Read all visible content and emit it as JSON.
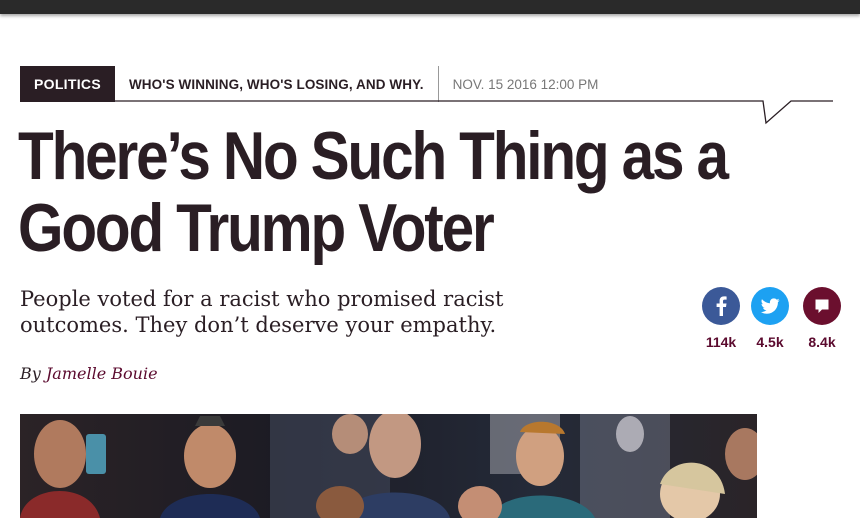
{
  "article": {
    "section": "POLITICS",
    "series": "WHO'S WINNING, WHO'S LOSING, AND WHY.",
    "date": "NOV. 15 2016 12:00 PM",
    "headline_line1": "There’s No Such Thing as a",
    "headline_line2": "Good Trump Voter",
    "dek_line1": "People voted for a racist who promised racist",
    "dek_line2": "outcomes. They don’t deserve your empathy.",
    "byline_prefix": "By",
    "author": "Jamelle Bouie"
  },
  "share": {
    "facebook": {
      "icon": "facebook-icon",
      "count": "114k",
      "color": "#3b5998"
    },
    "twitter": {
      "icon": "twitter-icon",
      "count": "4.5k",
      "color": "#1da1f2"
    },
    "comments": {
      "icon": "comment-icon",
      "count": "8.4k",
      "color": "#6b0f2e"
    }
  },
  "colors": {
    "brand_plum": "#2a1e24",
    "accent_maroon": "#5b0a2e"
  }
}
